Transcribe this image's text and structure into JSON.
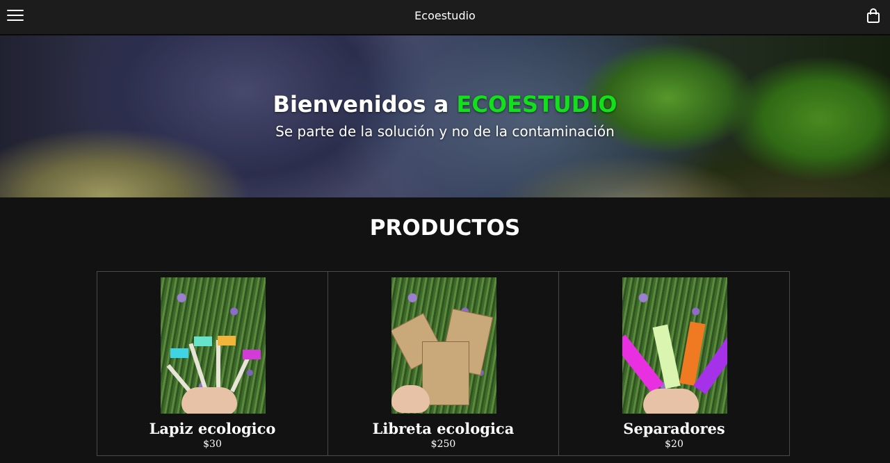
{
  "header": {
    "brand": "Ecoestudio",
    "menu_icon": "hamburger-menu-icon",
    "cart_icon": "shopping-bag-icon"
  },
  "hero": {
    "title_prefix": "Bienvenidos a ",
    "title_accent": "ECOESTUDIO",
    "subtitle": "Se parte de la solución y no de la contaminación",
    "accent_color": "#11e01a"
  },
  "products_section": {
    "title": "PRODUCTOS",
    "items": [
      {
        "name": "Lapiz ecologico",
        "price": "$30"
      },
      {
        "name": "Libreta ecologica",
        "price": "$250"
      },
      {
        "name": "Separadores",
        "price": "$20"
      }
    ]
  }
}
